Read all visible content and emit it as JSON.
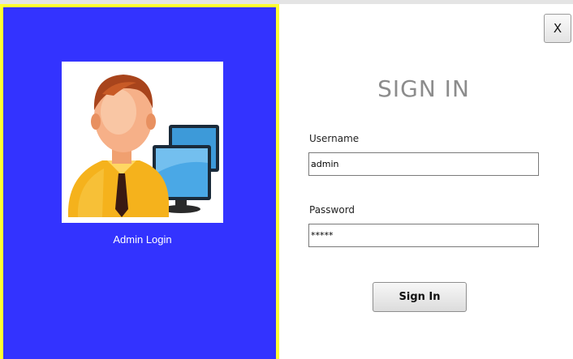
{
  "window": {
    "close_label": "X"
  },
  "left_panel": {
    "avatar_icon": "admin-user-with-computers-icon",
    "caption": "Admin Login",
    "colors": {
      "background": "#3333ff",
      "border": "#ffff33"
    }
  },
  "form": {
    "title": "SIGN IN",
    "username_label": "Username",
    "username_value": "admin",
    "password_label": "Password",
    "password_value": "*****",
    "submit_label": "Sign In"
  }
}
